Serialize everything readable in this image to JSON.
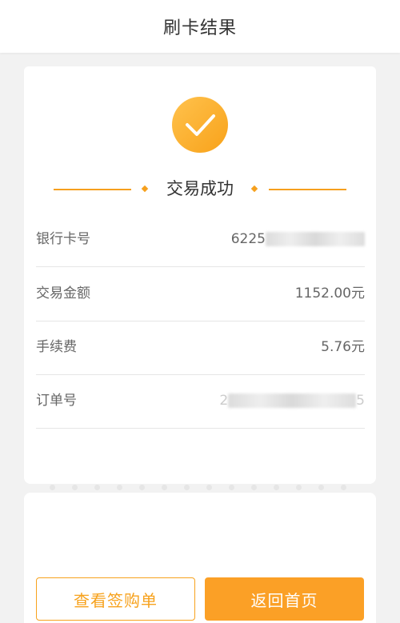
{
  "header": {
    "title": "刷卡结果"
  },
  "result": {
    "icon": "check-icon",
    "status": "交易成功",
    "accent_color": "#f6a01e"
  },
  "details": [
    {
      "label": "银行卡号",
      "value": "6225"
    },
    {
      "label": "交易金额",
      "value": "1152.00元"
    },
    {
      "label": "手续费",
      "value": "5.76元"
    },
    {
      "label": "订单号",
      "value": "2"
    }
  ],
  "details_suffix": {
    "order_tail": "5"
  },
  "actions": {
    "view_receipt": "查看签购单",
    "back_home": "返回首页"
  }
}
